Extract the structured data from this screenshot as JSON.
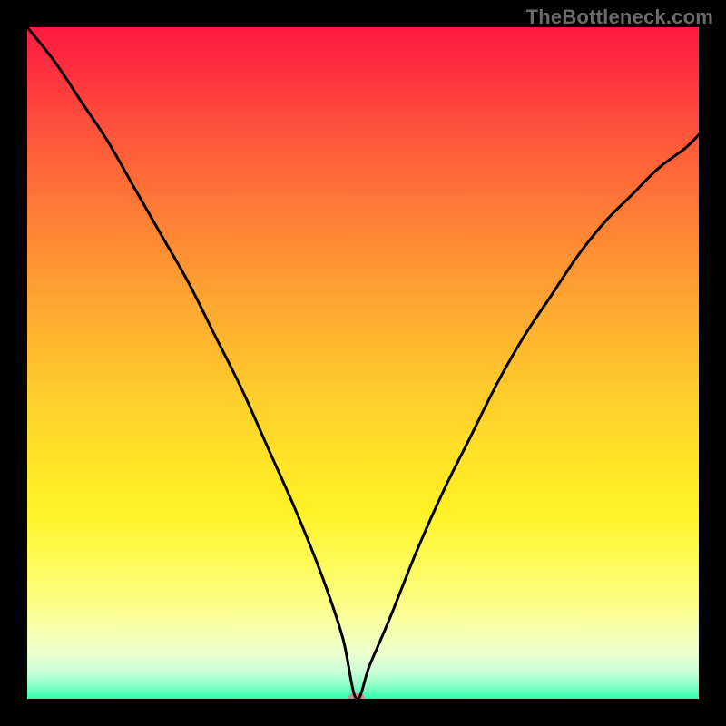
{
  "watermark": "TheBottleneck.com",
  "chart_data": {
    "type": "line",
    "title": "",
    "xlabel": "",
    "ylabel": "",
    "xlim": [
      0,
      100
    ],
    "ylim": [
      0,
      100
    ],
    "grid": false,
    "legend": false,
    "background": "vertical-gradient",
    "gradient_colors": {
      "top": "#ff1b3f",
      "mid_upper": "#ff8a34",
      "mid": "#ffe028",
      "mid_lower": "#fcfd88",
      "bottom": "#2bffad"
    },
    "marker": {
      "x": 49,
      "y": 0,
      "color": "#d68986",
      "shape": "rounded-rect"
    },
    "series": [
      {
        "name": "bottleneck-curve",
        "color": "#000000",
        "stroke_width": 3,
        "x": [
          0,
          4,
          8,
          12,
          16,
          20,
          24,
          28,
          32,
          36,
          40,
          44,
          47,
          49,
          51,
          54,
          58,
          62,
          66,
          70,
          74,
          78,
          82,
          86,
          90,
          94,
          98,
          100
        ],
        "values": [
          100,
          95,
          89,
          83,
          76,
          69,
          62,
          54,
          46,
          37,
          28,
          18,
          9,
          0,
          5,
          12,
          22,
          31,
          39,
          47,
          54,
          60,
          66,
          71,
          75,
          79,
          82,
          84
        ]
      }
    ]
  }
}
